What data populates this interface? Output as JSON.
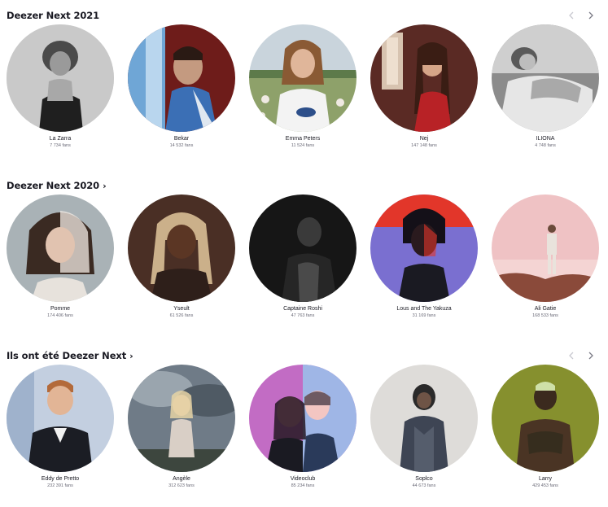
{
  "sections": [
    {
      "title": "Deezer Next 2021",
      "title_chevron": "",
      "show_nav": true,
      "nav": {
        "prev_enabled": false,
        "next_enabled": true
      },
      "artists": [
        {
          "name": "La Zarra",
          "fans": "7 734 fans",
          "portrait": "bw-woman-bust"
        },
        {
          "name": "Bekar",
          "fans": "14 532 fans",
          "portrait": "man-red-wall"
        },
        {
          "name": "Emma Peters",
          "fans": "11 524 fans",
          "portrait": "woman-field"
        },
        {
          "name": "Nej",
          "fans": "147 148 fans",
          "portrait": "woman-red-dress"
        },
        {
          "name": "ILIONA",
          "fans": "4 748 fans",
          "portrait": "bw-woman-lying"
        }
      ]
    },
    {
      "title": "Deezer Next 2020",
      "title_chevron": "›",
      "show_nav": false,
      "nav": {
        "prev_enabled": false,
        "next_enabled": false
      },
      "artists": [
        {
          "name": "Pomme",
          "fans": "174 406 fans",
          "portrait": "woman-split-hair"
        },
        {
          "name": "Yseult",
          "fans": "61 526 fans",
          "portrait": "woman-braids"
        },
        {
          "name": "Captaine Roshi",
          "fans": "47 763 fans",
          "portrait": "dark-man"
        },
        {
          "name": "Lous and The Yakuza",
          "fans": "31 169 fans",
          "portrait": "woman-red-purple"
        },
        {
          "name": "Ali Gatie",
          "fans": "168 533 fans",
          "portrait": "man-pink-sky"
        }
      ]
    },
    {
      "title": "Ils ont été Deezer Next",
      "title_chevron": "›",
      "show_nav": true,
      "nav": {
        "prev_enabled": false,
        "next_enabled": true
      },
      "artists": [
        {
          "name": "Eddy de Pretto",
          "fans": "232 391 fans",
          "portrait": "man-black-jacket"
        },
        {
          "name": "Angèle",
          "fans": "312 623 fans",
          "portrait": "woman-stormy-sky"
        },
        {
          "name": "Videoclub",
          "fans": "85 234 fans",
          "portrait": "couple-neon"
        },
        {
          "name": "Soplco",
          "fans": "44 673 fans",
          "portrait": "man-hoodie"
        },
        {
          "name": "Larry",
          "fans": "429 453 fans",
          "portrait": "man-tattoo-olive"
        }
      ]
    }
  ],
  "icons": {
    "prev": "chevron-left-icon",
    "next": "chevron-right-icon"
  },
  "colors": {
    "text": "#191922",
    "muted": "#6b6b78",
    "nav_disabled": "#c9c9d0",
    "nav_enabled": "#7b7b86"
  }
}
